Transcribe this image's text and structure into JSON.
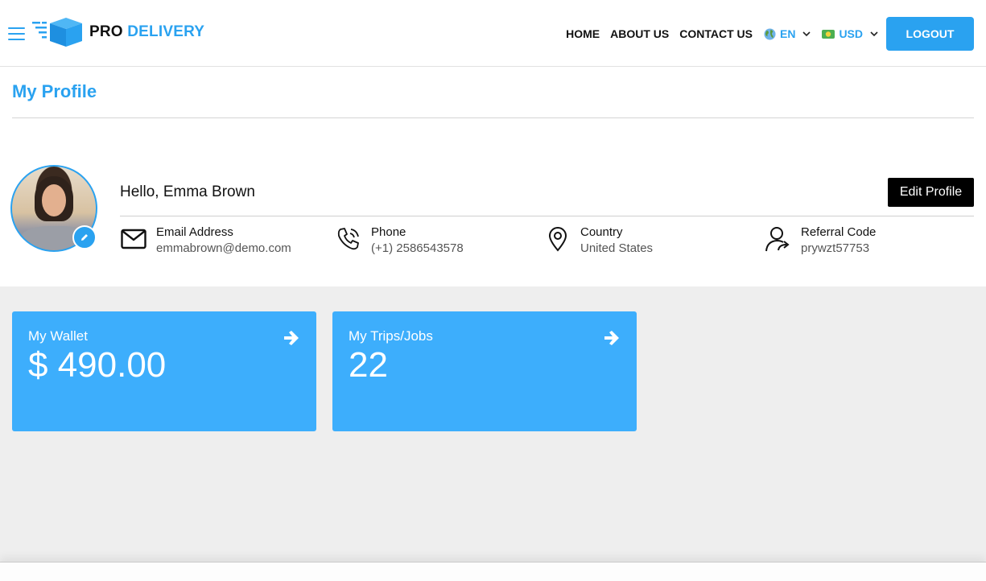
{
  "brand": {
    "name_part1": "PRO",
    "name_part2": "DELIVERY",
    "accent_color": "#2aa2f0"
  },
  "nav": {
    "links": [
      "HOME",
      "ABOUT US",
      "CONTACT US"
    ],
    "language": {
      "icon": "globe-icon",
      "value": "EN"
    },
    "currency": {
      "icon": "banknote-icon",
      "value": "USD"
    },
    "logout_label": "LOGOUT"
  },
  "page": {
    "title": "My Profile"
  },
  "profile": {
    "greeting": "Hello, Emma Brown",
    "edit_label": "Edit Profile",
    "fields": [
      {
        "icon": "envelope-icon",
        "label": "Email Address",
        "value": "emmabrown@demo.com"
      },
      {
        "icon": "phone-icon",
        "label": "Phone",
        "value": "(+1) 2586543578"
      },
      {
        "icon": "location-pin-icon",
        "label": "Country",
        "value": "United States"
      },
      {
        "icon": "user-share-icon",
        "label": "Referral Code",
        "value": "prywzt57753"
      }
    ]
  },
  "cards": [
    {
      "title": "My Wallet",
      "value": "$ 490.00",
      "icon": "arrow-right-icon"
    },
    {
      "title": "My Trips/Jobs",
      "value": "22",
      "icon": "arrow-right-icon"
    }
  ]
}
